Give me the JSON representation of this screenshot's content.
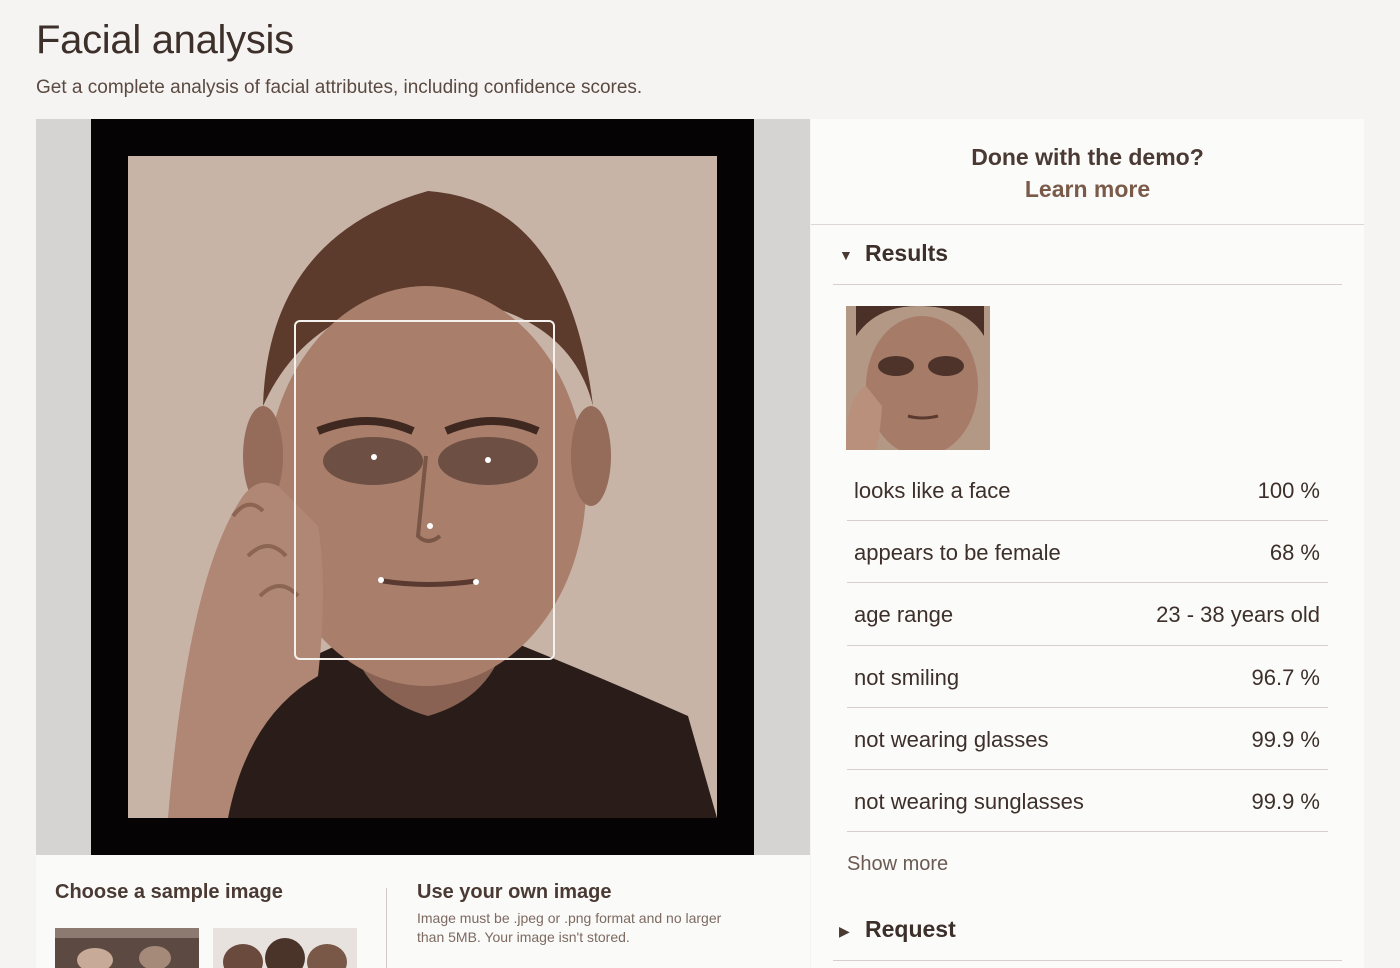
{
  "header": {
    "title": "Facial analysis",
    "subtitle": "Get a complete analysis of facial attributes, including confidence scores."
  },
  "sidebar": {
    "demo_question": "Done with the demo?",
    "learn_more": "Learn more",
    "results_label": "Results",
    "request_label": "Request",
    "show_more": "Show more",
    "results": [
      {
        "label": "looks like a face",
        "value": "100 %"
      },
      {
        "label": "appears to be female",
        "value": "68 %"
      },
      {
        "label": "age range",
        "value": "23 - 38 years old"
      },
      {
        "label": "not smiling",
        "value": "96.7 %"
      },
      {
        "label": "not wearing glasses",
        "value": "99.9 %"
      },
      {
        "label": "not wearing sunglasses",
        "value": "99.9 %"
      }
    ]
  },
  "bottom": {
    "sample_title": "Choose a sample image",
    "own_title": "Use your own image",
    "own_note": "Image must be .jpeg or .png format and no larger than 5MB. Your image isn't stored."
  },
  "icons": {
    "results_caret": "caret-down-icon",
    "request_caret": "caret-right-icon"
  }
}
